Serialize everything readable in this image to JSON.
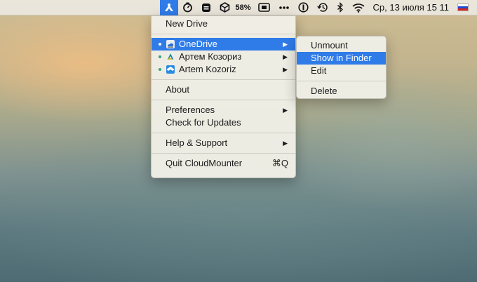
{
  "menubar": {
    "battery": "58%",
    "clock": "Ср, 13 июля 15 11",
    "icons": [
      "cloudmounter-icon",
      "timer-icon",
      "note-icon",
      "box-icon",
      "battery-indicator",
      "screen-icon",
      "more-dots-icon",
      "info-icon",
      "time-machine-icon",
      "bluetooth-icon",
      "wifi-icon",
      "russian-flag-icon"
    ]
  },
  "main_menu": {
    "new_drive": "New Drive",
    "drives": [
      {
        "label": "OneDrive",
        "icon": "onedrive-icon"
      },
      {
        "label": "Артем Козориз",
        "icon": "google-drive-icon"
      },
      {
        "label": "Artem Kozoriz",
        "icon": "dropbox-icon"
      }
    ],
    "about": "About",
    "preferences": "Preferences",
    "check_updates": "Check for Updates",
    "help": "Help & Support",
    "quit": "Quit CloudMounter",
    "quit_shortcut": "⌘Q"
  },
  "sub_menu": {
    "unmount": "Unmount",
    "show_in_finder": "Show in Finder",
    "edit": "Edit",
    "delete": "Delete"
  },
  "colors": {
    "accent": "#2f7be8",
    "dot_connected": "#2fa57e",
    "dot_active": "#ffffff"
  }
}
